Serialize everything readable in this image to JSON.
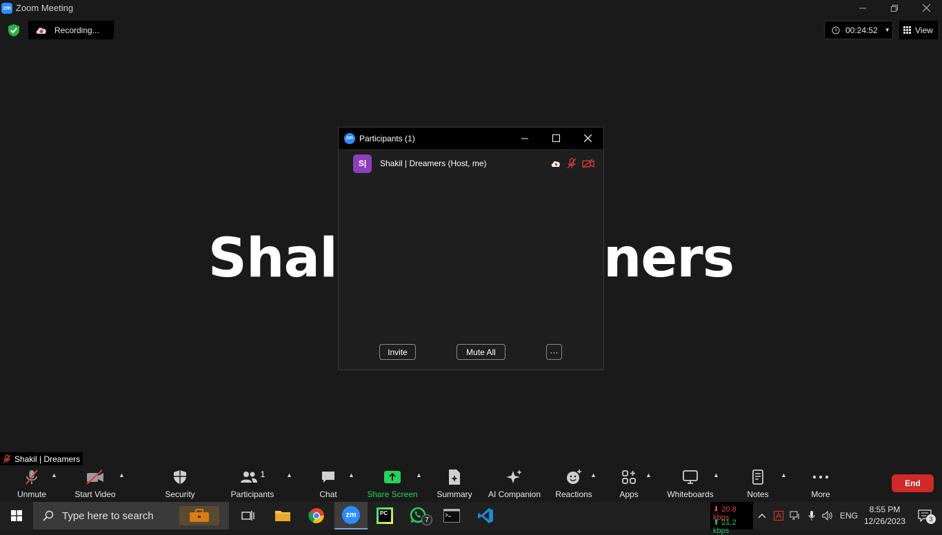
{
  "window": {
    "title": "Zoom Meeting",
    "logo": "zm",
    "controls": [
      "minimize-icon",
      "restore-icon",
      "close-icon"
    ]
  },
  "top_bar": {
    "recording_label": "Recording...",
    "timer": "00:24:52",
    "view_label": "View"
  },
  "video": {
    "display_name_left": "Shal",
    "display_name_right": "ners"
  },
  "participants_panel": {
    "title": "Participants (1)",
    "logo": "zm",
    "participant": {
      "initials": "S|",
      "name": "Shakil | Dreamers (Host, me)",
      "avatar_color": "#8a3fbb"
    },
    "invite_label": "Invite",
    "mute_all_label": "Mute All",
    "more_label": "···"
  },
  "name_tag": "Shakil | Dreamers",
  "toolbar": {
    "unmute": "Unmute",
    "start_video": "Start Video",
    "security": "Security",
    "participants": "Participants",
    "participants_count": "1",
    "chat": "Chat",
    "share_screen": "Share Screen",
    "summary": "Summary",
    "ai_companion": "AI Companion",
    "reactions": "Reactions",
    "apps": "Apps",
    "whiteboards": "Whiteboards",
    "notes": "Notes",
    "more": "More",
    "end": "End",
    "accent_green": "#27d15c",
    "end_color": "#cf2a27"
  },
  "taskbar": {
    "search_placeholder": "Type here to search",
    "whatsapp_badge": "7",
    "net_down": "20.8 kbps",
    "net_up": "21.2 kbps",
    "language": "ENG",
    "time": "8:55 PM",
    "date": "12/26/2023",
    "notification_count": "3",
    "pycharm_label": "PC",
    "zoom_label": "zm"
  }
}
